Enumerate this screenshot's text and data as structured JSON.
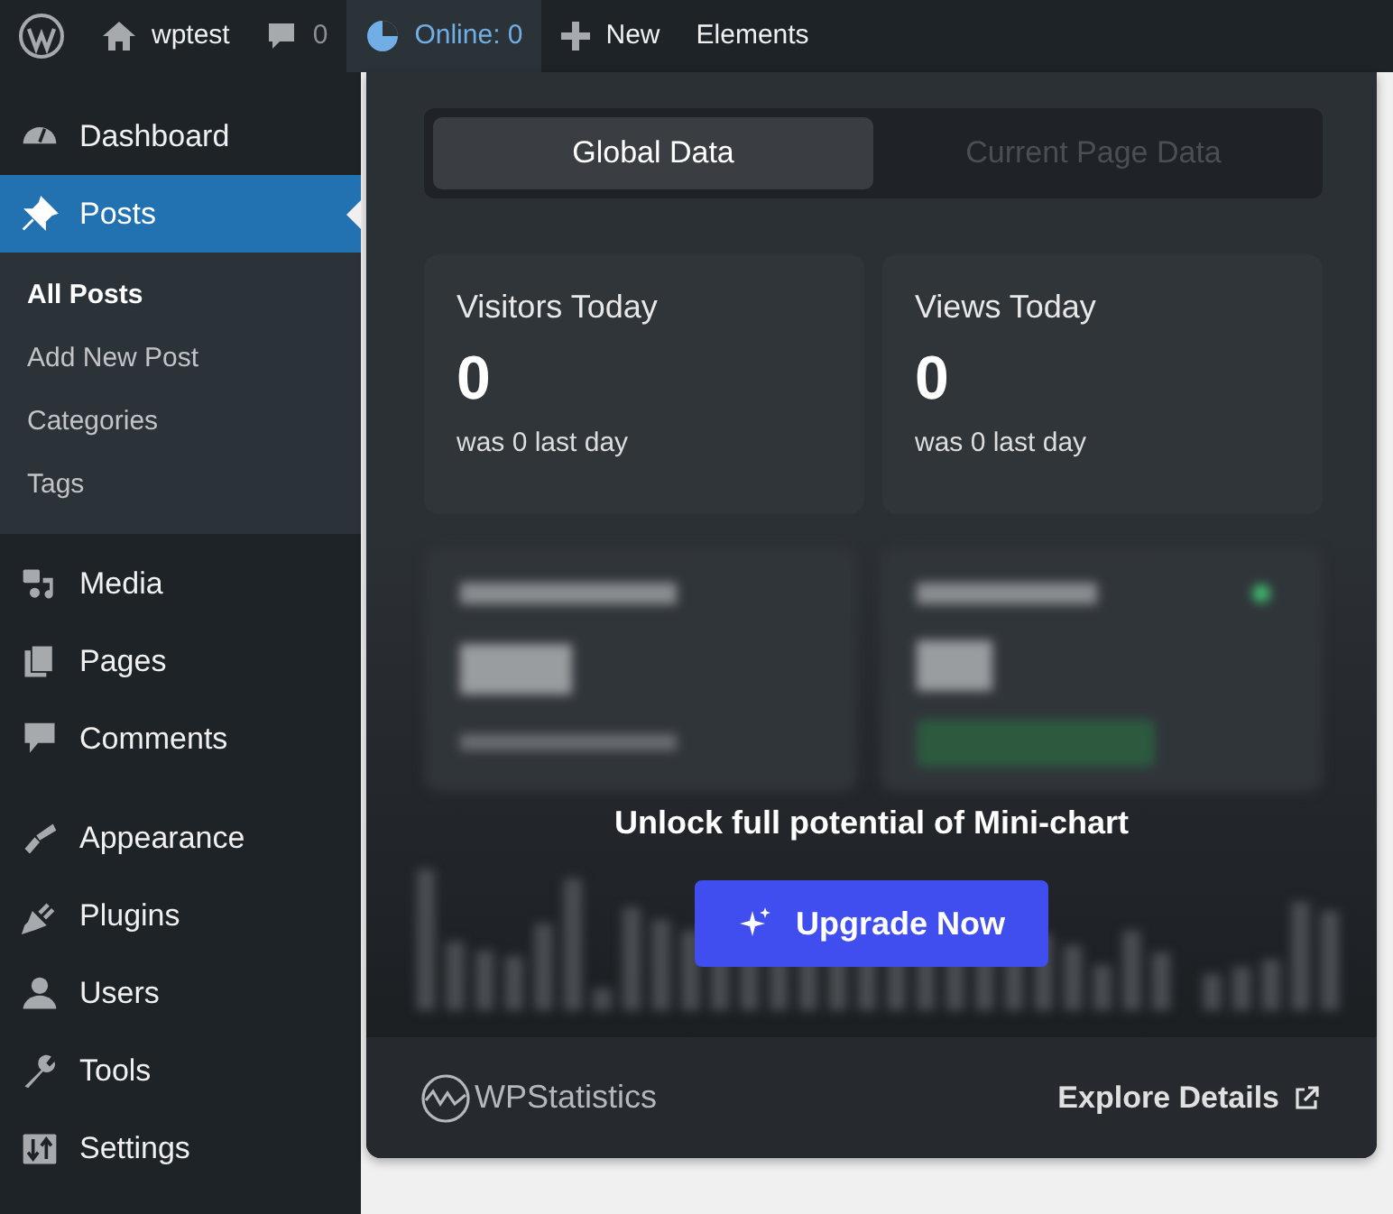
{
  "admin_bar": {
    "items": [
      {
        "kind": "logo",
        "selected": false
      },
      {
        "kind": "site",
        "label": "wptest",
        "selected": false
      },
      {
        "kind": "comments",
        "label": "0",
        "selected": false
      },
      {
        "kind": "online",
        "label": "Online: 0",
        "selected": true
      },
      {
        "kind": "new",
        "label": "New",
        "selected": false
      },
      {
        "kind": "text",
        "label": "Elements",
        "selected": false
      }
    ]
  },
  "sidebar": {
    "items": [
      {
        "kind": "dashboard",
        "label": "Dashboard",
        "selected": false
      },
      {
        "kind": "pin",
        "label": "Posts",
        "selected": true,
        "children": [
          {
            "label": "All Posts",
            "selected": true
          },
          {
            "label": "Add New Post",
            "selected": false
          },
          {
            "label": "Categories",
            "selected": false
          },
          {
            "label": "Tags",
            "selected": false
          }
        ]
      },
      {
        "kind": "media",
        "label": "Media",
        "selected": false
      },
      {
        "kind": "pages",
        "label": "Pages",
        "selected": false
      },
      {
        "kind": "comments",
        "label": "Comments",
        "selected": false
      },
      {
        "kind": "brush",
        "label": "Appearance",
        "selected": false
      },
      {
        "kind": "plug",
        "label": "Plugins",
        "selected": false
      },
      {
        "kind": "user",
        "label": "Users",
        "selected": false
      },
      {
        "kind": "wrench",
        "label": "Tools",
        "selected": false
      },
      {
        "kind": "settings",
        "label": "Settings",
        "selected": false
      }
    ]
  },
  "panel": {
    "tabs": [
      {
        "label": "Global Data",
        "selected": true
      },
      {
        "label": "Current Page Data",
        "selected": false
      }
    ],
    "stats": [
      {
        "label": "Visitors Today",
        "value": "0",
        "note": "was 0 last day"
      },
      {
        "label": "Views Today",
        "value": "0",
        "note": "was 0 last day"
      }
    ],
    "upsell": {
      "message": "Unlock full potential of Mini-chart",
      "button": "Upgrade Now"
    },
    "footer": {
      "brand": "WPStatistics",
      "link": "Explore Details"
    }
  }
}
